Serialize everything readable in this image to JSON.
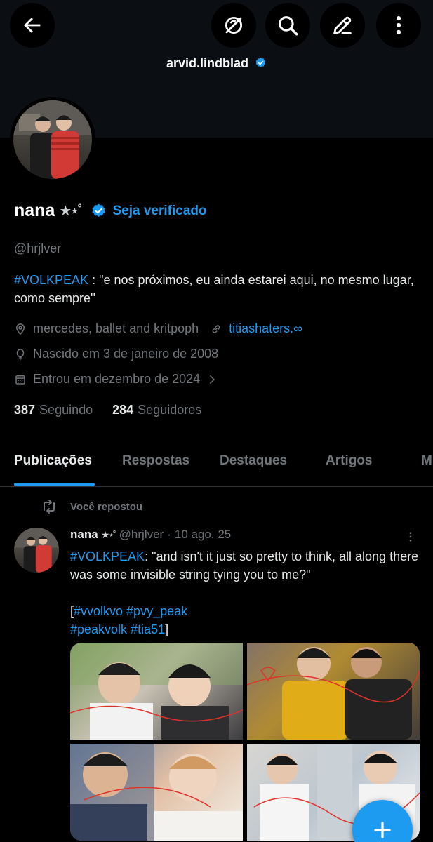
{
  "header": {
    "username": "arvid.lindblad",
    "icons": [
      "back-arrow-icon",
      "grok-icon",
      "search-icon",
      "edit-icon",
      "more-vertical-icon"
    ]
  },
  "profile": {
    "display_name": "nana",
    "name_stars": "★⋆˚",
    "get_verified_label": "Seja verificado",
    "handle": "@hrjlver",
    "bio_hashtag": "#VOLKPEAK",
    "bio_text": " : \"e nos próximos, eu ainda estarei aqui, no mesmo lugar, como sempre''",
    "location": "mercedes, ballet and kritpoph",
    "website": "titiashaters.∞",
    "birthday": "Nascido em 3 de janeiro de 2008",
    "joined": "Entrou em dezembro de 2024",
    "following_count": "387",
    "following_label": "Seguindo",
    "followers_count": "284",
    "followers_label": "Seguidores"
  },
  "tabs": [
    "Publicações",
    "Respostas",
    "Destaques",
    "Artigos",
    "M"
  ],
  "active_tab": "Publicações",
  "post": {
    "repost_label": "Você repostou",
    "author_name": "nana",
    "author_stars": "★⋆˚",
    "author_handle": "@hrjlver",
    "separator": "·",
    "date": "10 ago. 25",
    "text_hashtag": "#VOLKPEAK",
    "text_body": ": \"and isn't it just so pretty to think, all along there was some invisible string tying you to me?\"",
    "bracket_open": "[",
    "tags_line1": "#vvolkvo #pvy_peak",
    "tags_line2": "#peakvolk #tia51",
    "bracket_close": "]",
    "media_count": 4
  },
  "colors": {
    "accent": "#1d9bf0",
    "background": "#000000",
    "header_bg": "#0b0f14",
    "muted_text": "#71767b",
    "primary_text": "#e7e9ea"
  }
}
